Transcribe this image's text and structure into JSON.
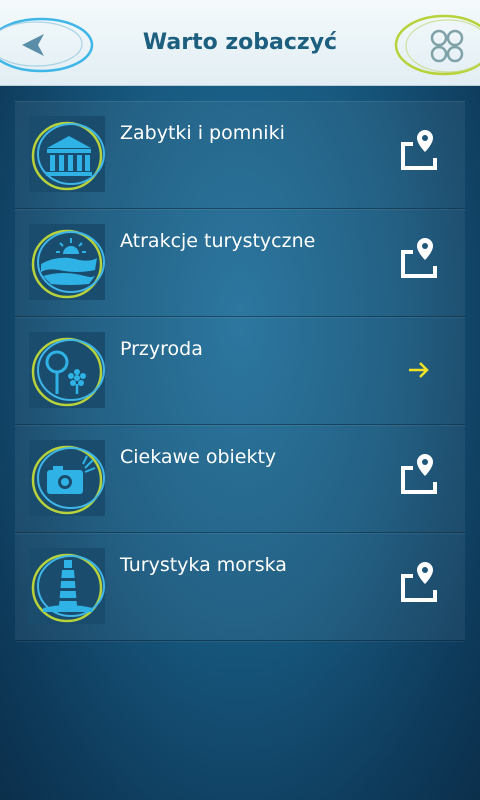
{
  "header": {
    "title": "Warto zobaczyć",
    "back_icon": "back-arrow-icon",
    "menu_icon": "grid-menu-icon"
  },
  "colors": {
    "header_text": "#1d5f7e",
    "icon_cyan": "#2fb3e6",
    "ring_green": "#b7d23a",
    "ring_blue": "#3fb6e8",
    "arrow_yellow": "#f2e227"
  },
  "categories": [
    {
      "label": "Zabytki i pomniki",
      "icon": "monument-building-icon",
      "action": "map-pin-icon"
    },
    {
      "label": "Atrakcje turystyczne",
      "icon": "landscape-sunrise-icon",
      "action": "map-pin-icon"
    },
    {
      "label": "Przyroda",
      "icon": "tree-flower-icon",
      "action": "arrow-right-icon"
    },
    {
      "label": "Ciekawe obiekty",
      "icon": "camera-icon",
      "action": "map-pin-icon"
    },
    {
      "label": "Turystyka morska",
      "icon": "lighthouse-icon",
      "action": "map-pin-icon"
    }
  ]
}
